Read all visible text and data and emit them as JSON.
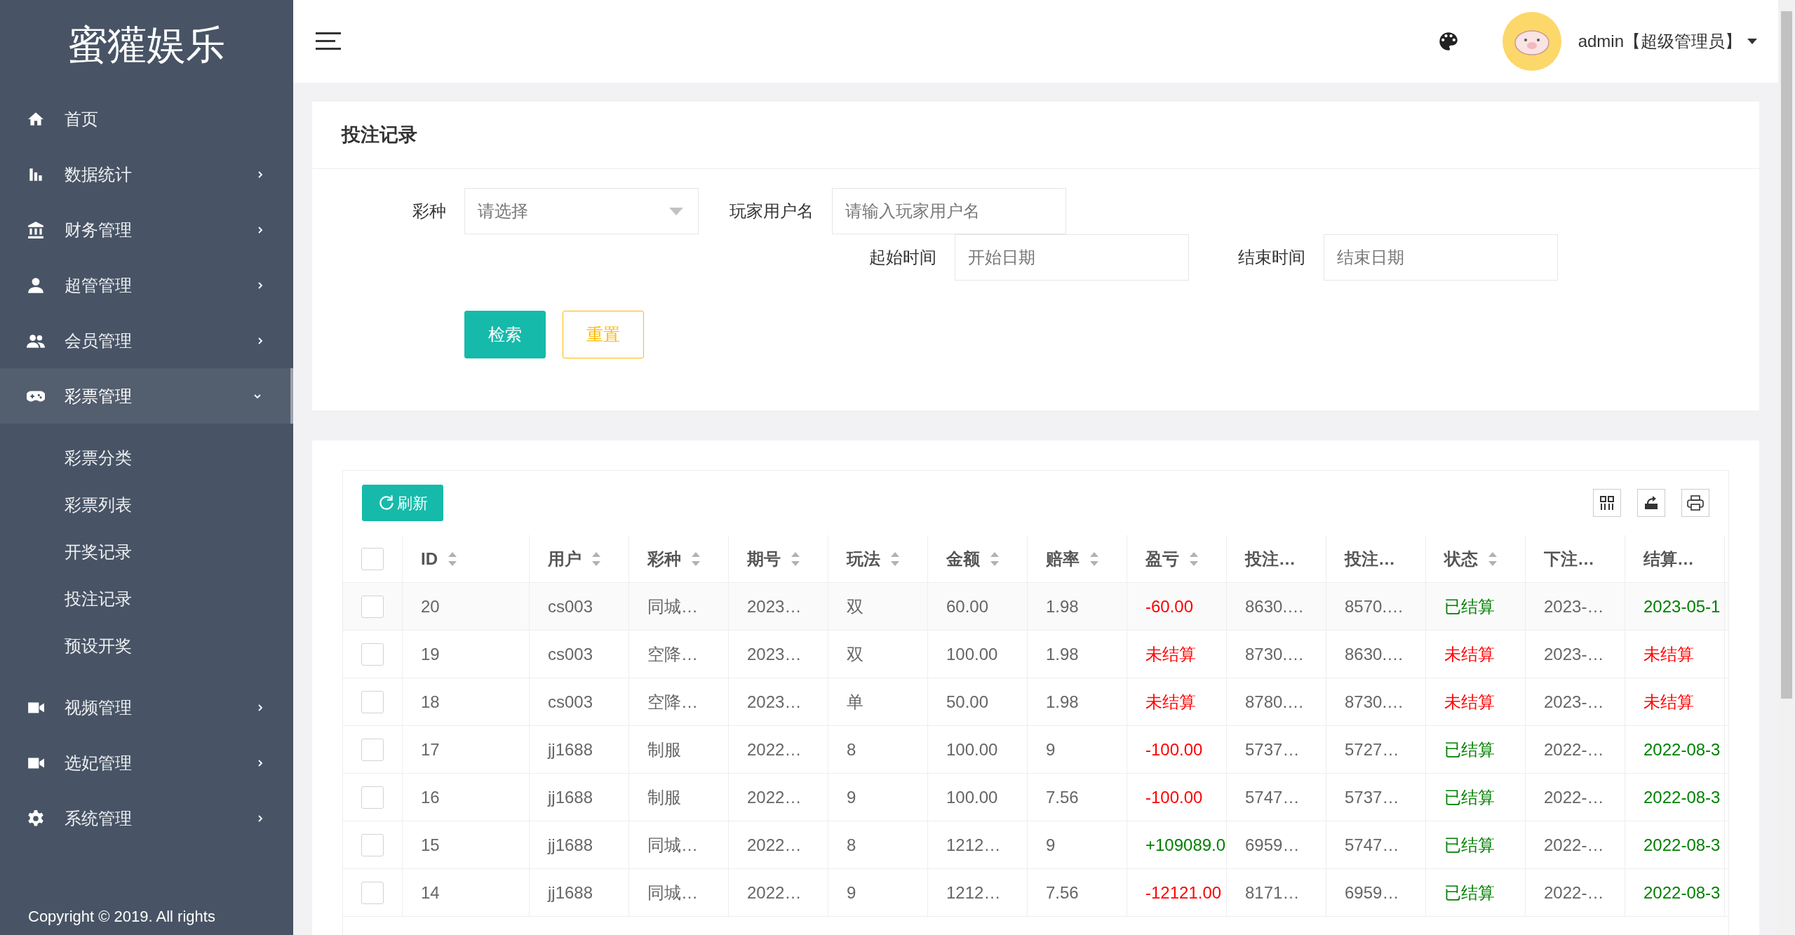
{
  "sidebar": {
    "logo": "蜜獾娱乐",
    "items": [
      {
        "label": "首页",
        "selected": false,
        "expandable": false
      },
      {
        "label": "数据统计",
        "selected": false,
        "expandable": true,
        "expanded": false
      },
      {
        "label": "财务管理",
        "selected": false,
        "expandable": true,
        "expanded": false
      },
      {
        "label": "超管管理",
        "selected": false,
        "expandable": true,
        "expanded": false
      },
      {
        "label": "会员管理",
        "selected": false,
        "expandable": true,
        "expanded": false
      },
      {
        "label": "彩票管理",
        "selected": true,
        "expandable": true,
        "expanded": true,
        "children": [
          {
            "label": "彩票分类",
            "selected": false
          },
          {
            "label": "彩票列表",
            "selected": false
          },
          {
            "label": "开奖记录",
            "selected": false
          },
          {
            "label": "投注记录",
            "selected": false
          },
          {
            "label": "预设开奖",
            "selected": false
          }
        ]
      },
      {
        "label": "视频管理",
        "selected": false,
        "expandable": true,
        "expanded": false
      },
      {
        "label": "选妃管理",
        "selected": false,
        "expandable": true,
        "expanded": false
      },
      {
        "label": "系统管理",
        "selected": false,
        "expandable": true,
        "expanded": false
      }
    ],
    "copyright": "Copyright © 2019. All rights"
  },
  "header": {
    "user": "admin【超级管理员】"
  },
  "page_title": "投注记录",
  "filters": [
    {
      "kind": "select",
      "label": "彩种",
      "placeholder": "请选择"
    },
    {
      "kind": "input",
      "label": "玩家用户名",
      "placeholder": "请输入玩家用户名"
    },
    {
      "kind": "input",
      "label": "起始时间",
      "placeholder": "开始日期"
    },
    {
      "kind": "input",
      "label": "结束时间",
      "placeholder": "结束日期"
    }
  ],
  "buttons": [
    {
      "kind": "primary",
      "label": "检索"
    },
    {
      "kind": "outline",
      "label": "重置"
    }
  ],
  "table": {
    "refresh_label": "刷新",
    "all_checked": false,
    "columns": [
      {
        "label": "ID",
        "sortable": true
      },
      {
        "label": "用户",
        "sortable": true
      },
      {
        "label": "彩种",
        "sortable": true
      },
      {
        "label": "期号",
        "sortable": true
      },
      {
        "label": "玩法",
        "sortable": true
      },
      {
        "label": "金额",
        "sortable": true
      },
      {
        "label": "赔率",
        "sortable": true
      },
      {
        "label": "盈亏",
        "sortable": true
      },
      {
        "label": "投注…",
        "sortable": false
      },
      {
        "label": "投注…",
        "sortable": false
      },
      {
        "label": "状态",
        "sortable": true
      },
      {
        "label": "下注…",
        "sortable": false
      },
      {
        "label": "结算…",
        "sortable": false
      }
    ],
    "rows": [
      {
        "checked": false,
        "cells": [
          {
            "text": "20"
          },
          {
            "text": "cs003"
          },
          {
            "text": "同城…"
          },
          {
            "text": "2023…"
          },
          {
            "text": "双"
          },
          {
            "text": "60.00"
          },
          {
            "text": "1.98"
          },
          {
            "text": "-60.00",
            "color": "#ff0000"
          },
          {
            "text": "8630.…"
          },
          {
            "text": "8570.…"
          },
          {
            "text": "已结算",
            "color": "#008000"
          },
          {
            "text": "2023-…"
          },
          {
            "text": "2023-05-1",
            "color": "#008000"
          }
        ]
      },
      {
        "checked": false,
        "cells": [
          {
            "text": "19"
          },
          {
            "text": "cs003"
          },
          {
            "text": "空降…"
          },
          {
            "text": "2023…"
          },
          {
            "text": "双"
          },
          {
            "text": "100.00"
          },
          {
            "text": "1.98"
          },
          {
            "text": "未结算",
            "color": "#ff0000"
          },
          {
            "text": "8730.…"
          },
          {
            "text": "8630.…"
          },
          {
            "text": "未结算",
            "color": "#ff0000"
          },
          {
            "text": "2023-…"
          },
          {
            "text": "未结算",
            "color": "#ff0000"
          }
        ]
      },
      {
        "checked": false,
        "cells": [
          {
            "text": "18"
          },
          {
            "text": "cs003"
          },
          {
            "text": "空降…"
          },
          {
            "text": "2023…"
          },
          {
            "text": "单"
          },
          {
            "text": "50.00"
          },
          {
            "text": "1.98"
          },
          {
            "text": "未结算",
            "color": "#ff0000"
          },
          {
            "text": "8780.…"
          },
          {
            "text": "8730.…"
          },
          {
            "text": "未结算",
            "color": "#ff0000"
          },
          {
            "text": "2023-…"
          },
          {
            "text": "未结算",
            "color": "#ff0000"
          }
        ]
      },
      {
        "checked": false,
        "cells": [
          {
            "text": "17"
          },
          {
            "text": "jj1688"
          },
          {
            "text": "制服"
          },
          {
            "text": "2022…"
          },
          {
            "text": "8"
          },
          {
            "text": "100.00"
          },
          {
            "text": "9"
          },
          {
            "text": "-100.00",
            "color": "#ff0000"
          },
          {
            "text": "5737…"
          },
          {
            "text": "5727…"
          },
          {
            "text": "已结算",
            "color": "#008000"
          },
          {
            "text": "2022-…"
          },
          {
            "text": "2022-08-3",
            "color": "#008000"
          }
        ]
      },
      {
        "checked": false,
        "cells": [
          {
            "text": "16"
          },
          {
            "text": "jj1688"
          },
          {
            "text": "制服"
          },
          {
            "text": "2022…"
          },
          {
            "text": "9"
          },
          {
            "text": "100.00"
          },
          {
            "text": "7.56"
          },
          {
            "text": "-100.00",
            "color": "#ff0000"
          },
          {
            "text": "5747…"
          },
          {
            "text": "5737…"
          },
          {
            "text": "已结算",
            "color": "#008000"
          },
          {
            "text": "2022-…"
          },
          {
            "text": "2022-08-3",
            "color": "#008000"
          }
        ]
      },
      {
        "checked": false,
        "cells": [
          {
            "text": "15"
          },
          {
            "text": "jj1688"
          },
          {
            "text": "同城…"
          },
          {
            "text": "2022…"
          },
          {
            "text": "8"
          },
          {
            "text": "1212…"
          },
          {
            "text": "9"
          },
          {
            "text": "+109089.0",
            "color": "#008000"
          },
          {
            "text": "6959…"
          },
          {
            "text": "5747…"
          },
          {
            "text": "已结算",
            "color": "#008000"
          },
          {
            "text": "2022-…"
          },
          {
            "text": "2022-08-3",
            "color": "#008000"
          }
        ]
      },
      {
        "checked": false,
        "cells": [
          {
            "text": "14"
          },
          {
            "text": "jj1688"
          },
          {
            "text": "同城…"
          },
          {
            "text": "2022…"
          },
          {
            "text": "9"
          },
          {
            "text": "1212…"
          },
          {
            "text": "7.56"
          },
          {
            "text": "-12121.00",
            "color": "#ff0000"
          },
          {
            "text": "8171…"
          },
          {
            "text": "6959…"
          },
          {
            "text": "已结算",
            "color": "#008000"
          },
          {
            "text": "2022-…"
          },
          {
            "text": "2022-08-3",
            "color": "#008000"
          }
        ]
      }
    ]
  }
}
